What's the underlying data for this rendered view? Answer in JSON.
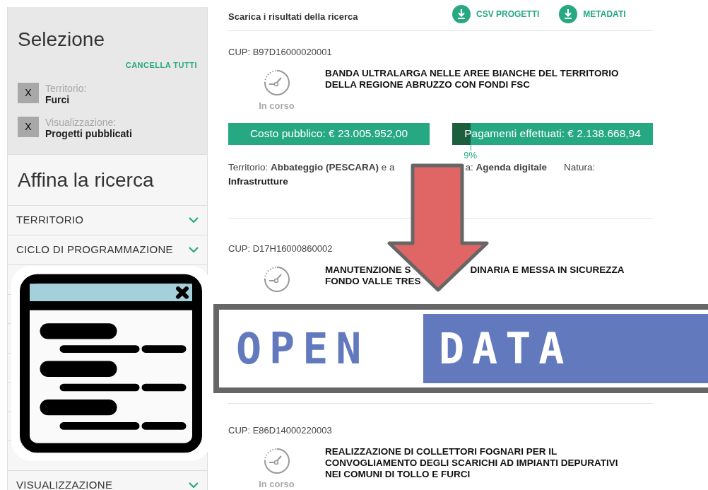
{
  "sidebar": {
    "selection": {
      "title": "Selezione",
      "clear_all": "CANCELLA TUTTI",
      "filters": [
        {
          "remove": "X",
          "label": "Territorio:",
          "value": "Furci"
        },
        {
          "remove": "X",
          "label": "Visualizzazione:",
          "value": "Progetti pubblicati"
        }
      ]
    },
    "refine": {
      "title": "Affina la ricerca",
      "sections": [
        {
          "label": "TERRITORIO",
          "chevron": true
        },
        {
          "label": "CICLO DI PROGRAMMAZIONE",
          "chevron": true
        },
        {
          "label": "VISUALIZZAZIONE",
          "chevron": true
        }
      ]
    }
  },
  "main": {
    "download": {
      "label": "Scarica i risultati della ricerca",
      "links": [
        "CSV PROGETTI",
        "METADATI"
      ]
    },
    "projects": [
      {
        "cup": "CUP: B97D16000020001",
        "status": "In corso",
        "title_lines": [
          [
            "BANDA ULTRALARGA NELLE AREE BIANCHE DEL TERRITORIO"
          ],
          [
            "DELLA REGIONE ABRUZZO CON FONDI FSC"
          ]
        ],
        "cost": "Costo pubblico: € 23.005.952,00",
        "payments": "Pagamenti effettuati: € 2.138.668,94",
        "level": 0.09,
        "percent": "9%",
        "details": {
          "part_1": "Territorio: **Abbateggio (PESCARA)** e a",
          "part_2": "a: **Agenda digitale**",
          "nature_label": "Natura:",
          "nature_value": "Infrastrutture"
        }
      },
      {
        "cup": "CUP: D17H16000860002",
        "title_lines": [
          [
            "MANUTENZIONE S",
            "DINARIA E MESSA IN SICUREZZA"
          ],
          [
            "FONDO VALLE TRES"
          ]
        ]
      },
      {
        "cup": "CUP: E86D14000220003",
        "status": "In corso",
        "title_lines": [
          [
            "REALIZZAZIONE DI COLLETTORI FOGNARI PER IL"
          ],
          [
            "CONVOGLIAMENTO DEGLI SCARICHI AD IMPIANTI DEPURATIVI"
          ],
          [
            "NEI COMUNI DI TOLLO E FURCI"
          ]
        ]
      }
    ]
  },
  "banner": {
    "word_1": "OPEN",
    "word_2": "DATA"
  }
}
